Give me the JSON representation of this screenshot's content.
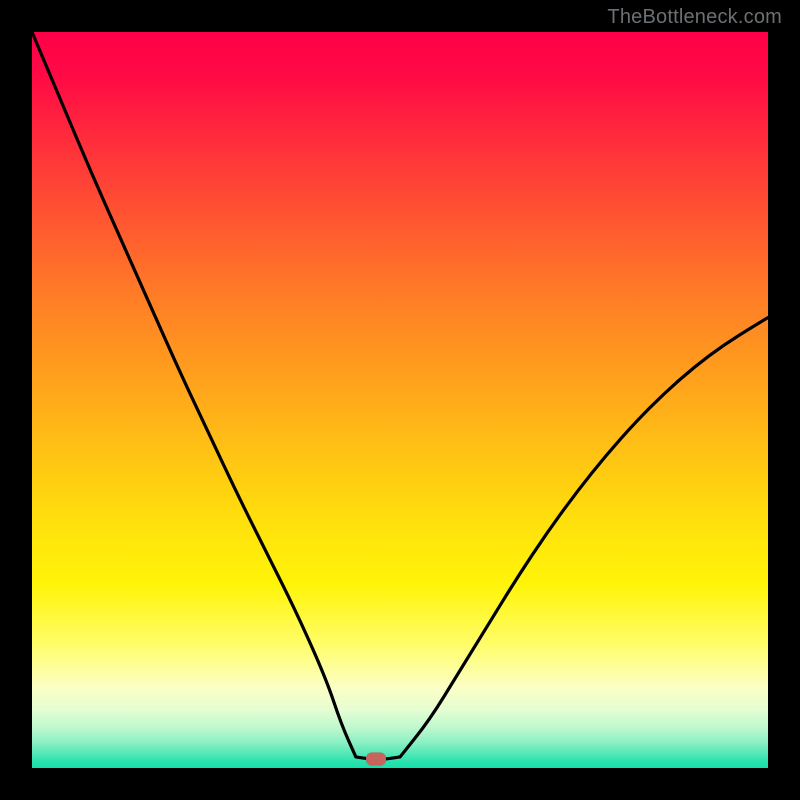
{
  "watermark": "TheBottleneck.com",
  "colors": {
    "frame": "#000000",
    "curve": "#000000",
    "marker": "#c7645d",
    "watermark_text": "#6b7074"
  },
  "marker": {
    "x_frac": 0.468,
    "y_frac": 0.988
  },
  "chart_data": {
    "type": "line",
    "title": "",
    "xlabel": "",
    "ylabel": "",
    "xlim": [
      0,
      1
    ],
    "ylim": [
      0,
      1
    ],
    "grid": false,
    "legend": false,
    "annotations": [
      "TheBottleneck.com"
    ],
    "series": [
      {
        "name": "left-descending-curve",
        "x": [
          0.0,
          0.04,
          0.08,
          0.12,
          0.16,
          0.2,
          0.24,
          0.28,
          0.32,
          0.36,
          0.4,
          0.42,
          0.44
        ],
        "y": [
          1.0,
          0.905,
          0.81,
          0.72,
          0.63,
          0.54,
          0.455,
          0.37,
          0.29,
          0.21,
          0.12,
          0.06,
          0.015
        ]
      },
      {
        "name": "valley-flat",
        "x": [
          0.44,
          0.46,
          0.48,
          0.5
        ],
        "y": [
          0.015,
          0.012,
          0.012,
          0.015
        ]
      },
      {
        "name": "right-ascending-curve",
        "x": [
          0.5,
          0.54,
          0.58,
          0.62,
          0.66,
          0.7,
          0.74,
          0.78,
          0.82,
          0.86,
          0.9,
          0.94,
          0.98,
          1.0
        ],
        "y": [
          0.015,
          0.065,
          0.13,
          0.195,
          0.26,
          0.32,
          0.375,
          0.425,
          0.47,
          0.51,
          0.545,
          0.575,
          0.6,
          0.612
        ]
      }
    ],
    "marker_point": {
      "x": 0.468,
      "y": 0.012
    }
  }
}
